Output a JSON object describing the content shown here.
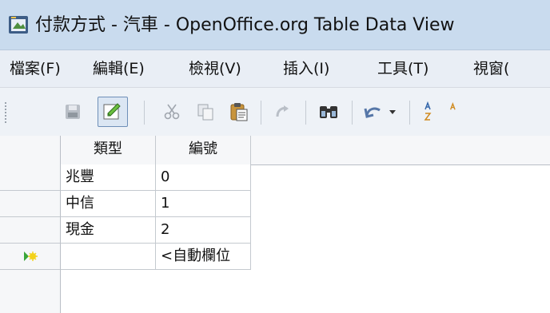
{
  "window": {
    "title": "付款方式 - 汽車 - OpenOffice.org Table Data View"
  },
  "menu": [
    "檔案(F)",
    "編輯(E)",
    "檢視(V)",
    "插入(I)",
    "工具(T)",
    "視窗("
  ],
  "toolbar": {
    "icons": [
      "save-icon",
      "edit-mode-icon",
      "cut-icon",
      "copy-icon",
      "paste-icon",
      "undo-icon",
      "find-icon",
      "redo-icon",
      "dropdown-arrow-icon",
      "sort-ascending-icon"
    ]
  },
  "table": {
    "columns": [
      "類型",
      "編號"
    ],
    "rows": [
      [
        "兆豐",
        "0"
      ],
      [
        "中信",
        "1"
      ],
      [
        "現金",
        "2"
      ]
    ],
    "new_row": [
      "",
      "<自動欄位"
    ]
  }
}
